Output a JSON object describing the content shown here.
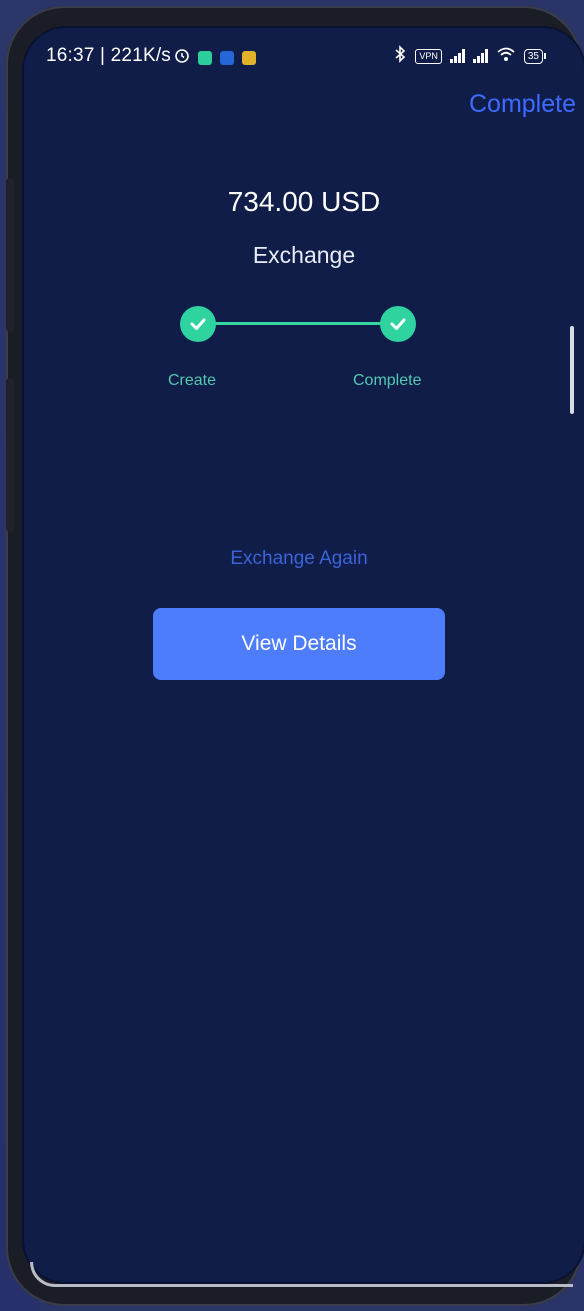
{
  "status_bar": {
    "time_and_speed": "16:37 | 221K/s",
    "vpn_label": "VPN",
    "battery_level": "35",
    "icons": [
      "alarm-icon",
      "app-icon",
      "app-icon",
      "app-icon",
      "bluetooth-icon",
      "vpn-icon",
      "signal-icon",
      "signal-icon",
      "wifi-icon",
      "battery-icon"
    ]
  },
  "header": {
    "complete_label": "Complete"
  },
  "summary": {
    "amount": "734.00 USD",
    "title": "Exchange"
  },
  "progress": {
    "steps": [
      {
        "label": "Create",
        "done": true
      },
      {
        "label": "Complete",
        "done": true
      }
    ],
    "accent_color": "#2fd39f"
  },
  "actions": {
    "exchange_again_label": "Exchange Again",
    "view_details_label": "View Details",
    "primary_color": "#4e7dfb"
  }
}
